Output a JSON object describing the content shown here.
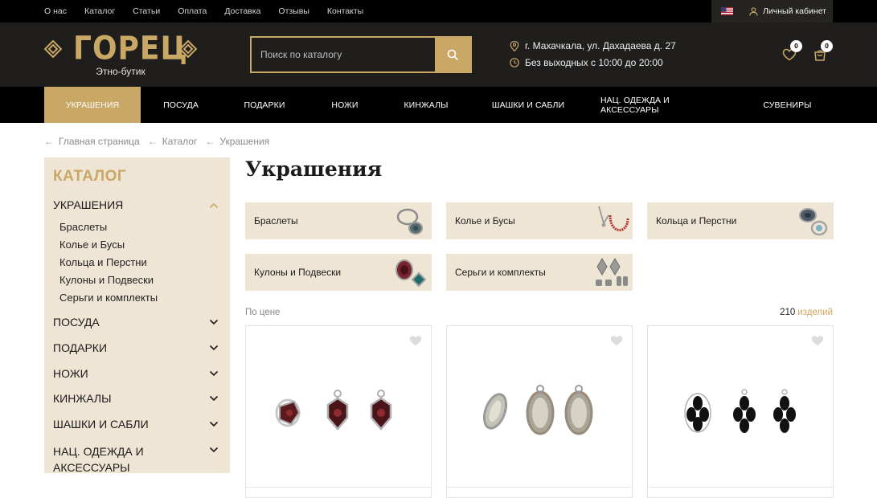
{
  "topbar": {
    "links": [
      "О нас",
      "Каталог",
      "Статьи",
      "Оплата",
      "Доставка",
      "Отзывы",
      "Контакты"
    ],
    "account_label": "Личный кабинет"
  },
  "header": {
    "logo_text": "ГОРЕЦ",
    "logo_subtitle": "Этно-бутик",
    "search_placeholder": "Поиск по каталогу",
    "address": "г. Махачкала, ул. Дахадаева д. 27",
    "hours": "Без выходных с 10:00 до 20:00",
    "favorites_count": "0",
    "cart_count": "0"
  },
  "nav": {
    "items": [
      "УКРАШЕНИЯ",
      "ПОСУДА",
      "ПОДАРКИ",
      "НОЖИ",
      "КИНЖАЛЫ",
      "ШАШКИ И САБЛИ",
      "НАЦ. ОДЕЖДА И АКСЕССУАРЫ",
      "СУВЕНИРЫ"
    ],
    "active": "УКРАШЕНИЯ"
  },
  "breadcrumb": [
    "Главная страница",
    "Каталог",
    "Украшения"
  ],
  "sidebar": {
    "title": "КАТАЛОГ",
    "categories": [
      {
        "label": "УКРАШЕНИЯ",
        "expanded": true,
        "children": [
          "Браслеты",
          "Колье и Бусы",
          "Кольца и Перстни",
          "Кулоны и Подвески",
          "Серьги и комплекты"
        ]
      },
      {
        "label": "ПОСУДА",
        "expanded": false
      },
      {
        "label": "ПОДАРКИ",
        "expanded": false
      },
      {
        "label": "НОЖИ",
        "expanded": false
      },
      {
        "label": "КИНЖАЛЫ",
        "expanded": false
      },
      {
        "label": "ШАШКИ И САБЛИ",
        "expanded": false
      },
      {
        "label": "НАЦ. ОДЕЖДА И АКСЕССУАРЫ",
        "expanded": false
      }
    ]
  },
  "main": {
    "title": "Украшения",
    "subcategories": [
      "Браслеты",
      "Колье и Бусы",
      "Кольца и Перстни",
      "Кулоны и Подвески",
      "Серьги и комплекты"
    ],
    "sort_label": "По цене",
    "count": "210",
    "count_unit": "изделий"
  },
  "colors": {
    "accent": "#c9a866",
    "beige": "#efe5d5",
    "dark": "#1f1e1c",
    "black": "#000000"
  },
  "icons": [
    "us-flag-icon",
    "user-icon",
    "search-icon",
    "location-pin-icon",
    "clock-icon",
    "heart-icon",
    "cart-icon",
    "chevron-up-icon",
    "chevron-down-icon",
    "arrow-left-icon"
  ]
}
